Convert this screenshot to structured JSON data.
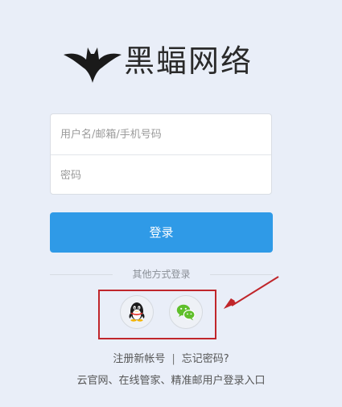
{
  "brand": {
    "logo_text": "黑蝠网络",
    "logo_icon": "bat-logo-icon"
  },
  "form": {
    "username_placeholder": "用户名/邮箱/手机号码",
    "password_placeholder": "密码",
    "username_value": "",
    "password_value": "",
    "login_label": "登录"
  },
  "other_login": {
    "label": "其他方式登录",
    "options": [
      {
        "name": "QQ",
        "icon": "qq-penguin-icon"
      },
      {
        "name": "WeChat",
        "icon": "wechat-icon"
      }
    ]
  },
  "links": {
    "register": "注册新帐号",
    "separator": "|",
    "forgot": "忘记密码?"
  },
  "footer": {
    "text": "云官网、在线管家、精准邮用户登录入口"
  },
  "colors": {
    "background": "#e9eef8",
    "primary": "#2f9ae7",
    "highlight": "#c0262b",
    "wechat": "#5fbf2a"
  }
}
